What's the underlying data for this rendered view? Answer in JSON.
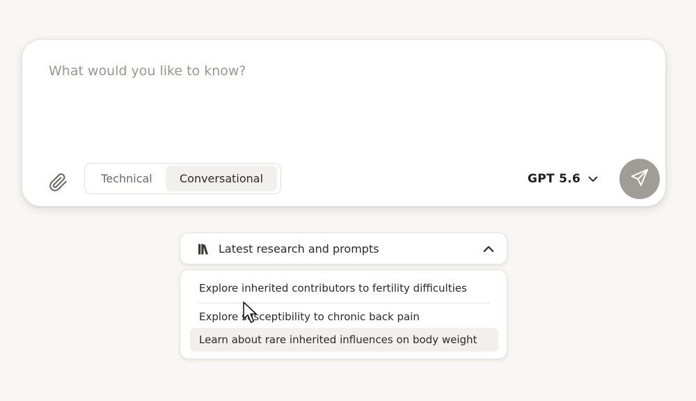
{
  "composer": {
    "placeholder": "What would you like to know?",
    "value": "",
    "attach_icon": "paperclip-icon",
    "modes": [
      {
        "label": "Technical",
        "selected": false
      },
      {
        "label": "Conversational",
        "selected": true
      }
    ],
    "model": {
      "label": "GPT 5.6",
      "icon": "chevron-down-icon"
    },
    "send_icon": "paper-plane-icon",
    "send_button_color": "#a09c96"
  },
  "prompts": {
    "header_icon": "books-icon",
    "title": "Latest research and prompts",
    "toggle_icon": "chevron-up-icon",
    "items": [
      {
        "label": "Explore inherited contributors to fertility difficulties"
      },
      {
        "label": "Explore susceptibility to chronic back pain"
      },
      {
        "label": "Learn about rare inherited influences on body weight"
      }
    ]
  },
  "colors": {
    "background": "#f8f7f5",
    "surface": "#ffffff",
    "border": "#e6e2dc",
    "hover": "#f2f0ed",
    "text": "#2b2a28",
    "muted_text": "#6d6a64"
  }
}
